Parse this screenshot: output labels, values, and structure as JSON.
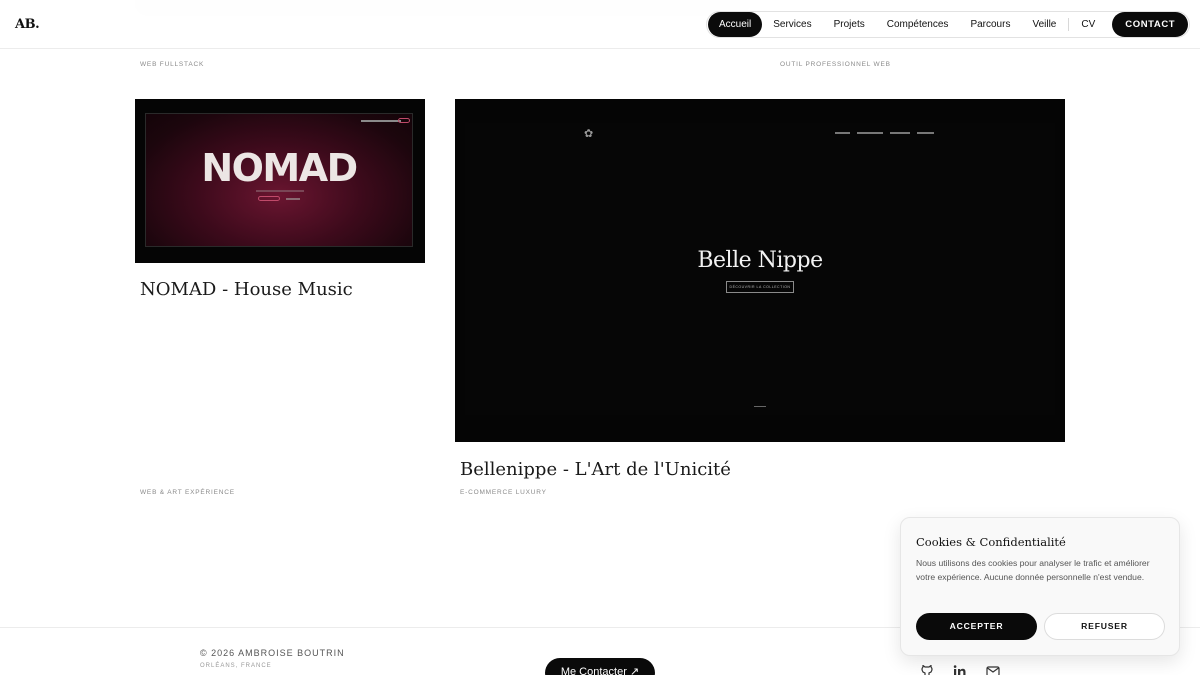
{
  "header": {
    "logo": "AB.",
    "nav": [
      {
        "label": "Accueil",
        "active": true
      },
      {
        "label": "Services"
      },
      {
        "label": "Projets"
      },
      {
        "label": "Compétences"
      },
      {
        "label": "Parcours"
      },
      {
        "label": "Veille"
      }
    ],
    "cv_label": "CV",
    "contact_label": "CONTACT"
  },
  "previous_row": {
    "category_left": "WEB FULLSTACK",
    "category_right": "OUTIL PROFESSIONNEL WEB"
  },
  "projects": [
    {
      "title": "NOMAD - House Music",
      "category": "WEB & ART EXPÉRIENCE",
      "thumbnail_text": "NOMAD"
    },
    {
      "title": "Bellenippe - L'Art de l'Unicité",
      "category": "E-COMMERCE LUXURY",
      "thumbnail_text": "Belle Nippe",
      "thumbnail_button": "DÉCOUVRIR LA COLLECTION"
    }
  ],
  "cookie": {
    "title": "Cookies & Confidentialité",
    "text": "Nous utilisons des cookies pour analyser le trafic et améliorer votre expérience. Aucune donnée personnelle n'est vendue.",
    "accept_label": "ACCEPTER",
    "refuse_label": "REFUSER"
  },
  "footer": {
    "copyright": "© 2026 AMBROISE BOUTRIN",
    "location": "ORLÉANS, FRANCE",
    "contact_button": "Me Contacter ↗",
    "icons": [
      "github-icon",
      "linkedin-icon",
      "mail-icon"
    ]
  },
  "colors": {
    "accent": "#0b0b0b",
    "nomad_bg": "#3c0a1b",
    "background": "#ffffff"
  }
}
